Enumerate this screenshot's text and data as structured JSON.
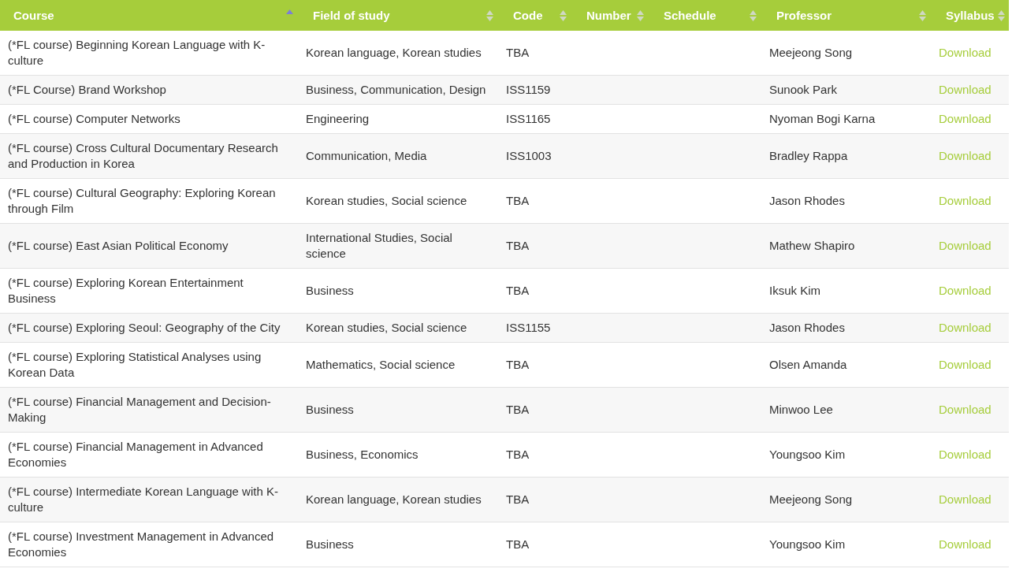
{
  "table": {
    "columns": [
      {
        "label": "Course",
        "sorted": true
      },
      {
        "label": "Field of study",
        "sorted": false
      },
      {
        "label": "Code",
        "sorted": false
      },
      {
        "label": "Number",
        "sorted": false
      },
      {
        "label": "Schedule",
        "sorted": false
      },
      {
        "label": "Professor",
        "sorted": false
      },
      {
        "label": "Syllabus",
        "sorted": false
      }
    ],
    "rows": [
      {
        "course": "(*FL course) Beginning Korean Language with K-culture",
        "field": "Korean language, Korean studies",
        "code": "TBA",
        "professor": "Meejeong Song",
        "syllabus": "Download"
      },
      {
        "course": "(*FL Course) Brand Workshop",
        "field": "Business, Communication, Design",
        "code": "ISS1159",
        "professor": "Sunook Park",
        "syllabus": "Download"
      },
      {
        "course": "(*FL course) Computer Networks",
        "field": "Engineering",
        "code": "ISS1165",
        "professor": "Nyoman Bogi Karna",
        "syllabus": "Download"
      },
      {
        "course": "(*FL course) Cross Cultural Documentary Research and Production in Korea",
        "field": "Communication, Media",
        "code": "ISS1003",
        "professor": "Bradley Rappa",
        "syllabus": "Download"
      },
      {
        "course": "(*FL course) Cultural Geography: Exploring Korean through Film",
        "field": "Korean studies, Social science",
        "code": "TBA",
        "professor": "Jason Rhodes",
        "syllabus": "Download"
      },
      {
        "course": "(*FL course) East Asian Political Economy",
        "field": "International Studies, Social science",
        "code": "TBA",
        "professor": "Mathew Shapiro",
        "syllabus": "Download"
      },
      {
        "course": "(*FL course) Exploring Korean Entertainment Business",
        "field": "Business",
        "code": "TBA",
        "professor": "Iksuk Kim",
        "syllabus": "Download"
      },
      {
        "course": "(*FL course) Exploring Seoul: Geography of the City",
        "field": "Korean studies, Social science",
        "code": "ISS1155",
        "professor": "Jason Rhodes",
        "syllabus": "Download"
      },
      {
        "course": "(*FL course) Exploring Statistical Analyses using Korean Data",
        "field": "Mathematics, Social science",
        "code": "TBA",
        "professor": "Olsen Amanda",
        "syllabus": "Download"
      },
      {
        "course": "(*FL course) Financial Management and Decision-Making",
        "field": "Business",
        "code": "TBA",
        "professor": "Minwoo Lee",
        "syllabus": "Download"
      },
      {
        "course": "(*FL course) Financial Management in Advanced Economies",
        "field": "Business, Economics",
        "code": "TBA",
        "professor": "Youngsoo Kim",
        "syllabus": "Download"
      },
      {
        "course": "(*FL course) Intermediate Korean Language with K-culture",
        "field": "Korean language, Korean studies",
        "code": "TBA",
        "professor": "Meejeong Song",
        "syllabus": "Download"
      },
      {
        "course": "(*FL course) Investment Management in Advanced Economies",
        "field": "Business",
        "code": "TBA",
        "professor": "Youngsoo Kim",
        "syllabus": "Download"
      }
    ]
  }
}
